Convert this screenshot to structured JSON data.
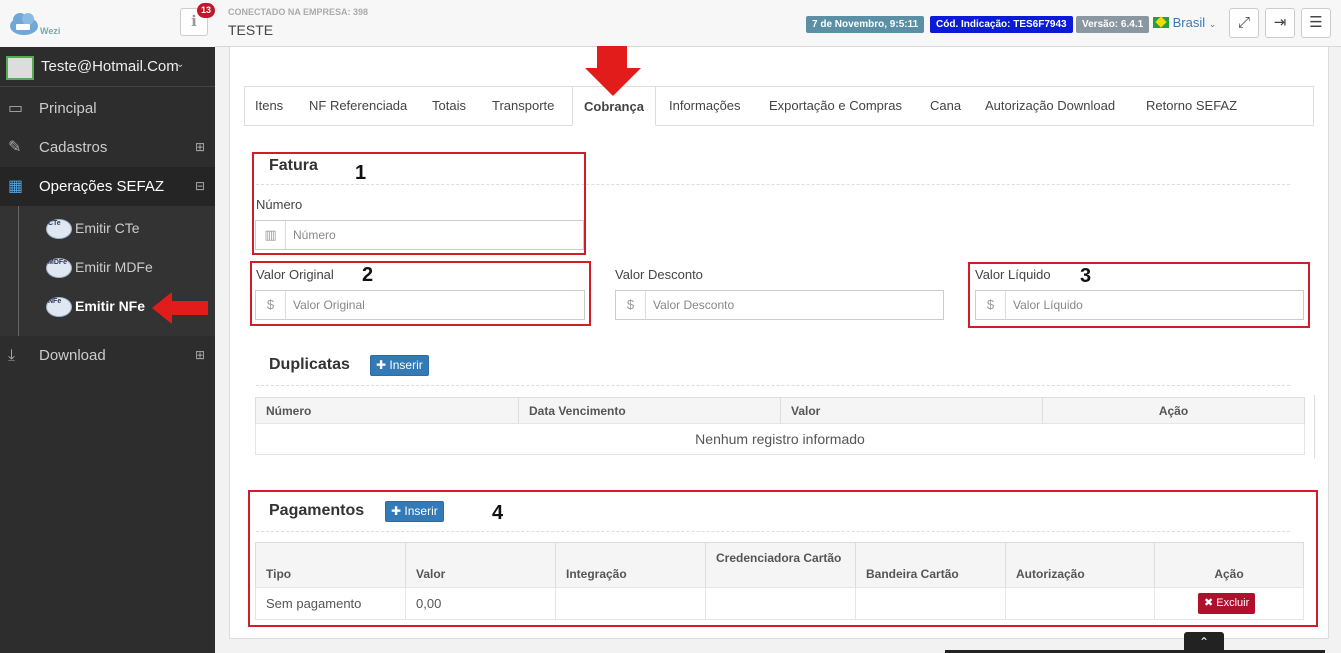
{
  "header": {
    "notifications_count": "13",
    "connected_label": "CONECTADO NA EMPRESA: 398",
    "company_name": "TESTE",
    "datetime": "7 de Novembro, 9:5:11",
    "indicacao": "Cód. Indicação: TES6F7943",
    "version": "Versão: 6.4.1",
    "country": "Brasil",
    "logo_text": "Wezi"
  },
  "sidebar": {
    "user": "Teste@Hotmail.Com",
    "items": [
      {
        "label": "Principal"
      },
      {
        "label": "Cadastros"
      },
      {
        "label": "Operações SEFAZ"
      },
      {
        "label": "Download"
      }
    ],
    "sub_items": [
      {
        "label": "Emitir CTe",
        "badge": "CTe"
      },
      {
        "label": "Emitir MDFe",
        "badge": "MDFe"
      },
      {
        "label": "Emitir NFe",
        "badge": "NFe"
      }
    ]
  },
  "tabs": [
    "Itens",
    "NF Referenciada",
    "Totais",
    "Transporte",
    "Cobrança",
    "Informações",
    "Exportação e Compras",
    "Cana",
    "Autorização Download",
    "Retorno SEFAZ"
  ],
  "fatura": {
    "title": "Fatura",
    "numero_label": "Número",
    "numero_placeholder": "Número",
    "valor_original_label": "Valor Original",
    "valor_original_placeholder": "Valor Original",
    "valor_desconto_label": "Valor Desconto",
    "valor_desconto_placeholder": "Valor Desconto",
    "valor_liquido_label": "Valor Líquido",
    "valor_liquido_placeholder": "Valor Líquido"
  },
  "duplicatas": {
    "title": "Duplicatas",
    "insert_label": "Inserir",
    "columns": [
      "Número",
      "Data Vencimento",
      "Valor",
      "Ação"
    ],
    "empty_message": "Nenhum registro informado"
  },
  "pagamentos": {
    "title": "Pagamentos",
    "insert_label": "Inserir",
    "columns": [
      "Tipo",
      "Valor",
      "Integração",
      "Credenciadora Cartão",
      "Bandeira Cartão",
      "Autorização",
      "Ação"
    ],
    "rows": [
      {
        "tipo": "Sem pagamento",
        "valor": "0,00",
        "action": "Excluir"
      }
    ]
  },
  "annotations": [
    "1",
    "2",
    "3",
    "4"
  ],
  "colors": {
    "sidebar": "#2d2d2d",
    "primary": "#337ab7",
    "danger": "#b0102b",
    "highlight": "#d21c2b"
  }
}
